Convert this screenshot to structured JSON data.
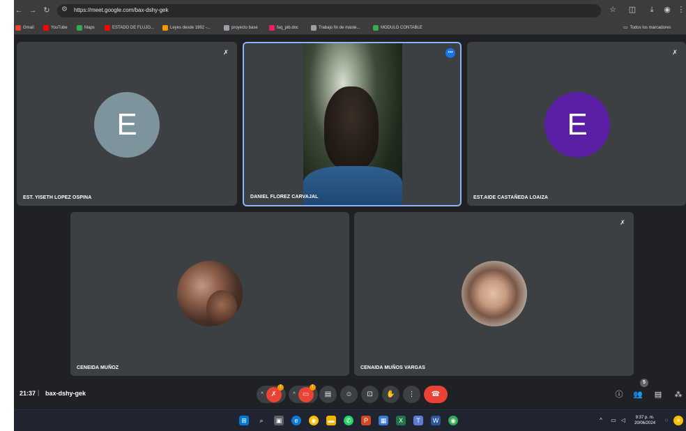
{
  "browser": {
    "url": "https://meet.google.com/bax-dshy-gek",
    "bookmarks": [
      {
        "label": "Gmail",
        "color": "#ea4335"
      },
      {
        "label": "YouTube",
        "color": "#ff0000"
      },
      {
        "label": "Maps",
        "color": "#34a853"
      },
      {
        "label": "ESTADO DE FLUJO...",
        "color": "#ff0000"
      },
      {
        "label": "Leyes desde 1992 -...",
        "color": "#f29900"
      },
      {
        "label": "proyecto base",
        "color": "#9aa0a6"
      },
      {
        "label": "faq_pib.doc",
        "color": "#e91e63"
      },
      {
        "label": "Trabajo fin de máste...",
        "color": "#9aa0a6"
      },
      {
        "label": "MODULO CONTABLE",
        "color": "#34a853"
      }
    ],
    "all_bookmarks_label": "Todos los marcadores"
  },
  "participants": [
    {
      "name": "EST. YISETH LOPEZ OSPINA",
      "initial": "E",
      "avatar_color": "#7e949d",
      "muted": true
    },
    {
      "name": "DANIEL FLOREZ CARVAJAL",
      "video": true,
      "active": true
    },
    {
      "name": "EST.AIDE CASTAÑEDA LOAIZA",
      "initial": "E",
      "avatar_color": "#5b1fa6",
      "muted": true
    },
    {
      "name": "CENEIDA MUÑOZ",
      "photo": true
    },
    {
      "name": "CENAIDA MUÑOS VARGAS",
      "photo": true,
      "muted": true
    }
  ],
  "meeting": {
    "time": "21:37",
    "separator": "|",
    "code": "bax-dshy-gek",
    "mic_badge": "!",
    "cam_badge": "!",
    "people_count": "5"
  },
  "taskbar": {
    "time": "9:37 p. m.",
    "date": "20/06/2024"
  }
}
